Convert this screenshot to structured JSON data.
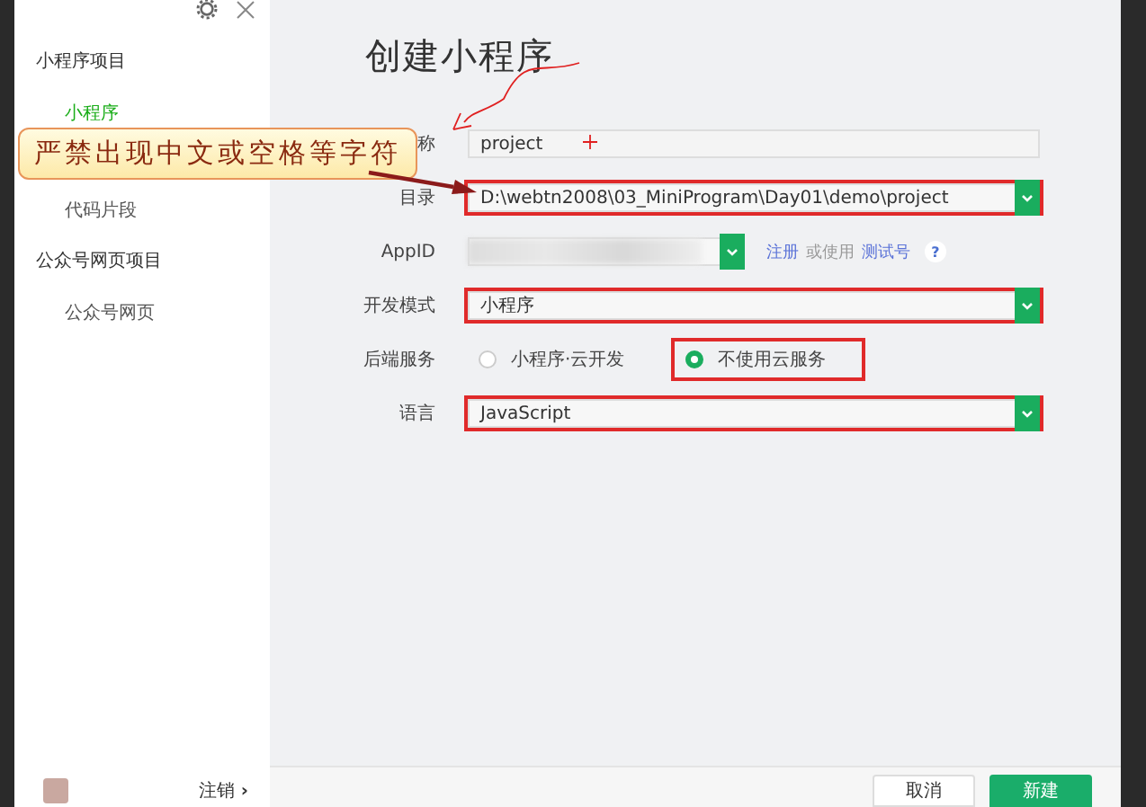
{
  "sidebar": {
    "groups": [
      {
        "label": "小程序项目",
        "items": [
          {
            "label": "小程序",
            "selected": true
          },
          {
            "label": "代码片段",
            "selected": false
          }
        ]
      },
      {
        "label": "公众号网页项目",
        "items": [
          {
            "label": "公众号网页",
            "selected": false
          }
        ]
      }
    ],
    "logout": "注销",
    "logout_arrow": "›"
  },
  "title": "创建小程序",
  "form": [
    {
      "kind": "input",
      "label": "称",
      "value": "project",
      "highlighted": false
    },
    {
      "kind": "select",
      "label": "目录",
      "value": "D:\\webtn2008\\03_MiniProgram\\Day01\\demo\\project",
      "highlighted": true
    },
    {
      "kind": "appid",
      "label": "AppID",
      "links": [
        {
          "text": "注册",
          "link": true
        },
        {
          "text": "或使用",
          "link": false
        },
        {
          "text": "测试号",
          "link": true
        }
      ],
      "help": "?",
      "highlighted": false
    },
    {
      "kind": "select",
      "label": "开发模式",
      "value": "小程序",
      "highlighted": true
    },
    {
      "kind": "radio",
      "label": "后端服务",
      "options": [
        {
          "label": "小程序·云开发",
          "selected": false,
          "highlighted": false
        },
        {
          "label": "不使用云服务",
          "selected": true,
          "highlighted": true
        }
      ]
    },
    {
      "kind": "select",
      "label": "语言",
      "value": "JavaScript",
      "highlighted": true
    }
  ],
  "callout": "严禁出现中文或空格等字符",
  "buttons": [
    {
      "label": "取消",
      "primary": false
    },
    {
      "label": "新建",
      "primary": true
    }
  ]
}
